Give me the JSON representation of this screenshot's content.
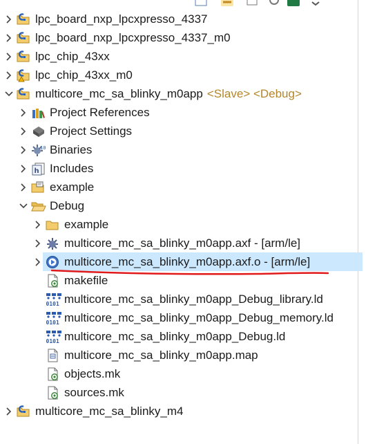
{
  "toolbar": {
    "buttons": [
      "collapse-all-icon",
      "link-editor-icon",
      "filter-icon",
      "sync-icon",
      "excel-icon",
      "view-menu-icon"
    ]
  },
  "tree": [
    {
      "id": "n1",
      "depth": 0,
      "label": "lpc_board_nxp_lpcxpresso_4337",
      "icon": "project-folder-icon",
      "expanded": false
    },
    {
      "id": "n2",
      "depth": 0,
      "label": "lpc_board_nxp_lpcxpresso_4337_m0",
      "icon": "project-folder-icon",
      "expanded": false
    },
    {
      "id": "n3",
      "depth": 0,
      "label": "lpc_chip_43xx",
      "icon": "project-folder-icon",
      "expanded": false
    },
    {
      "id": "n4",
      "depth": 0,
      "label": "lpc_chip_43xx_m0",
      "icon": "project-folder-warning-icon",
      "expanded": false
    },
    {
      "id": "n5",
      "depth": 0,
      "label": "multicore_mc_sa_blinky_m0app",
      "decoration": "<Slave> <Debug>",
      "icon": "project-folder-icon",
      "expanded": true
    },
    {
      "id": "n6",
      "depth": 1,
      "label": "Project References",
      "icon": "books-icon",
      "expanded": false
    },
    {
      "id": "n7",
      "depth": 1,
      "label": "Project Settings",
      "icon": "chip-icon",
      "expanded": false
    },
    {
      "id": "n8",
      "depth": 1,
      "label": "Binaries",
      "icon": "binaries-icon",
      "expanded": false
    },
    {
      "id": "n9",
      "depth": 1,
      "label": "Includes",
      "icon": "includes-icon",
      "expanded": false
    },
    {
      "id": "n10",
      "depth": 1,
      "label": "example",
      "icon": "source-folder-icon",
      "expanded": false
    },
    {
      "id": "n11",
      "depth": 1,
      "label": "Debug",
      "icon": "folder-open-icon",
      "expanded": true
    },
    {
      "id": "n12",
      "depth": 2,
      "label": "example",
      "icon": "folder-icon",
      "expanded": false
    },
    {
      "id": "n13",
      "depth": 2,
      "label": "multicore_mc_sa_blinky_m0app.axf - [arm/le]",
      "icon": "bug-binary-icon",
      "expanded": false
    },
    {
      "id": "n14",
      "depth": 2,
      "label": "multicore_mc_sa_blinky_m0app.axf.o - [arm/le]",
      "icon": "object-file-icon",
      "expanded": false,
      "selected": true
    },
    {
      "id": "n15",
      "depth": 2,
      "label": "makefile",
      "icon": "make-file-icon"
    },
    {
      "id": "n16",
      "depth": 2,
      "label": "multicore_mc_sa_blinky_m0app_Debug_library.ld",
      "icon": "linker-script-icon"
    },
    {
      "id": "n17",
      "depth": 2,
      "label": "multicore_mc_sa_blinky_m0app_Debug_memory.ld",
      "icon": "linker-script-icon"
    },
    {
      "id": "n18",
      "depth": 2,
      "label": "multicore_mc_sa_blinky_m0app_Debug.ld",
      "icon": "linker-script-icon"
    },
    {
      "id": "n19",
      "depth": 2,
      "label": "multicore_mc_sa_blinky_m0app.map",
      "icon": "map-file-icon"
    },
    {
      "id": "n20",
      "depth": 2,
      "label": "objects.mk",
      "icon": "make-file-icon"
    },
    {
      "id": "n21",
      "depth": 2,
      "label": "sources.mk",
      "icon": "make-file-icon"
    },
    {
      "id": "n22",
      "depth": 0,
      "label": "multicore_mc_sa_blinky_m4",
      "icon": "project-folder-icon",
      "expanded": false
    }
  ],
  "colors": {
    "selection": "#cce8ff",
    "decoration": "#b4862b",
    "annotation": "#e0191b",
    "folder": "#e8b84a",
    "project_badge": "#2a62b8"
  }
}
